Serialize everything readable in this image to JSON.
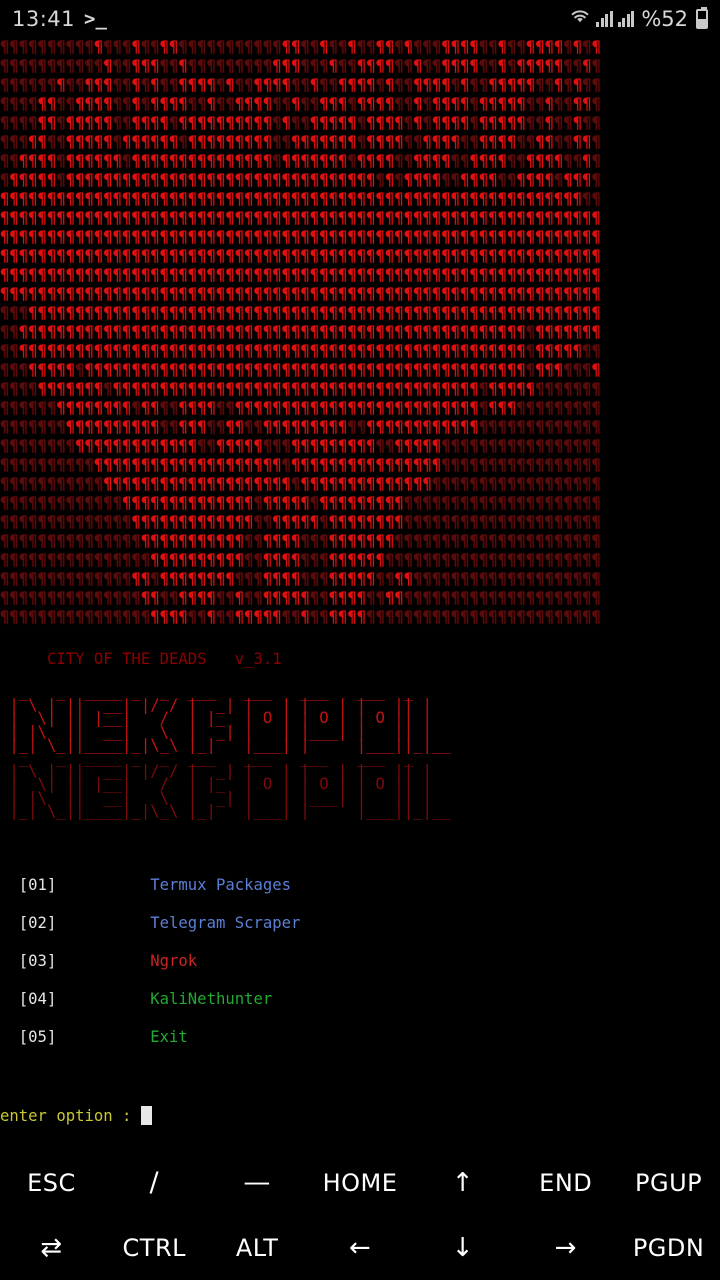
{
  "status_bar": {
    "clock": "13:41",
    "notification_icon": ">_",
    "wifi_icon": "wifi-icon",
    "signal_icon_1": "signal-bars-icon",
    "signal_icon_2": "signal-bars-icon",
    "battery_percent": "%52",
    "battery_icon": "battery-icon",
    "battery_level": 52
  },
  "terminal": {
    "banner_ascii": "skull-ascii-art",
    "subtitle": "     CITY OF THE DEADS   v_3.1",
    "logo_text": "NEKROPOL",
    "prompt_label": "enter option : ",
    "cursor": "block-cursor",
    "colors": {
      "skull_bright": "#e01010",
      "skull_dim": "#5a0c0c",
      "subtitle": "#8b0000",
      "logo": "#c21212",
      "index": "#e6e6e6",
      "blue": "#5c7fd6",
      "red": "#cc2222",
      "green": "#22aa33",
      "prompt": "#c8c832",
      "background": "#000000"
    },
    "menu": [
      {
        "index": "  [01]",
        "gap": "          ",
        "label": "Termux Packages",
        "color_name": "blue"
      },
      {
        "index": "  [02]",
        "gap": "          ",
        "label": "Telegram Scraper",
        "color_name": "blue"
      },
      {
        "index": "  [03]",
        "gap": "          ",
        "label": "Ngrok",
        "color_name": "red"
      },
      {
        "index": "  [04]",
        "gap": "          ",
        "label": "KaliNethunter",
        "color_name": "green"
      },
      {
        "index": "  [05]",
        "gap": "          ",
        "label": "Exit",
        "color_name": "green"
      }
    ]
  },
  "extra_keys": {
    "row1": [
      {
        "label": "ESC",
        "name": "key-esc"
      },
      {
        "label": "/",
        "name": "key-slash"
      },
      {
        "label": "—",
        "name": "key-dash"
      },
      {
        "label": "HOME",
        "name": "key-home"
      },
      {
        "label": "↑",
        "name": "key-arrow-up"
      },
      {
        "label": "END",
        "name": "key-end"
      },
      {
        "label": "PGUP",
        "name": "key-pgup"
      }
    ],
    "row2": [
      {
        "label": "⇄",
        "name": "key-tab"
      },
      {
        "label": "CTRL",
        "name": "key-ctrl"
      },
      {
        "label": "ALT",
        "name": "key-alt"
      },
      {
        "label": "←",
        "name": "key-arrow-left"
      },
      {
        "label": "↓",
        "name": "key-arrow-down"
      },
      {
        "label": "→",
        "name": "key-arrow-right"
      },
      {
        "label": "PGDN",
        "name": "key-pgdn"
      }
    ]
  }
}
